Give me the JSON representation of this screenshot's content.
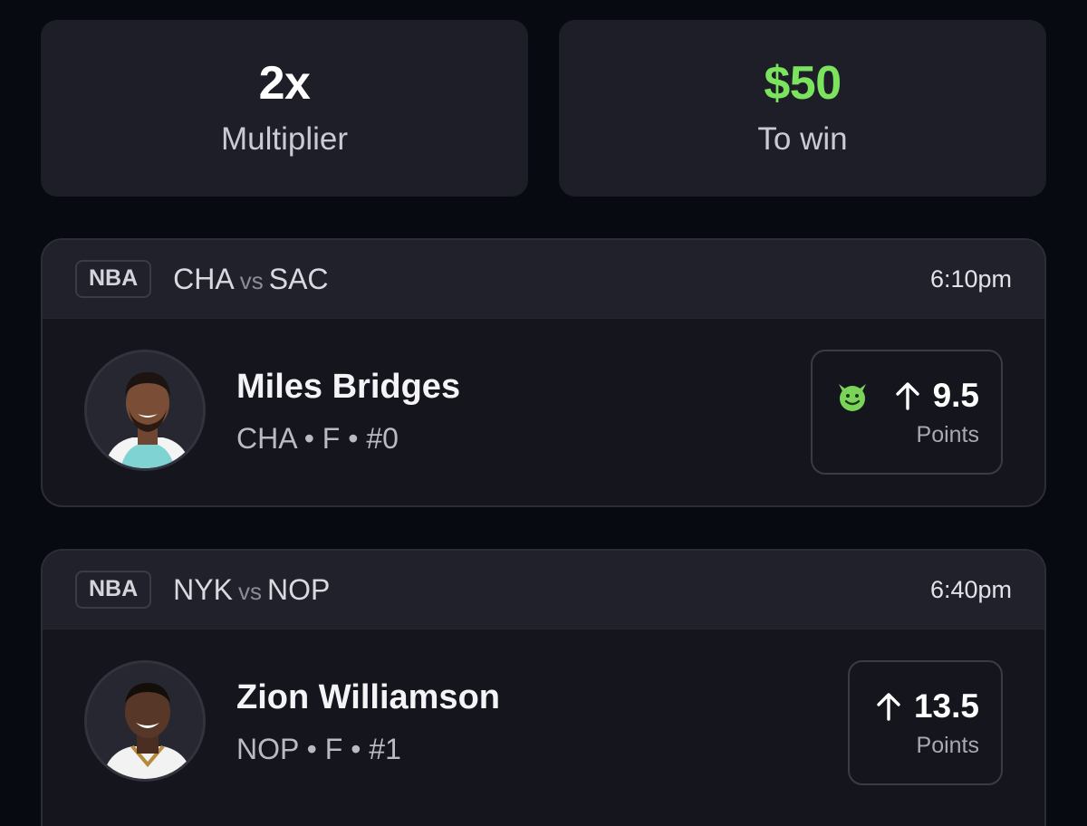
{
  "summary": {
    "multiplier_value": "2x",
    "multiplier_label": "Multiplier",
    "to_win_value": "$50",
    "to_win_label": "To win"
  },
  "picks": [
    {
      "league": "NBA",
      "team_a": "CHA",
      "vs": "vs",
      "team_b": "SAC",
      "time": "6:10pm",
      "player_name": "Miles Bridges",
      "player_meta": "CHA • F • #0",
      "direction_icon": "arrow-up-icon",
      "line": "9.5",
      "stat": "Points",
      "badge_icon": "devil-emoji-icon",
      "jersey_color": "#7fd3d3"
    },
    {
      "league": "NBA",
      "team_a": "NYK",
      "vs": "vs",
      "team_b": "NOP",
      "time": "6:40pm",
      "player_name": "Zion Williamson",
      "player_meta": "NOP • F • #1",
      "direction_icon": "arrow-up-icon",
      "line": "13.5",
      "stat": "Points",
      "jersey_color": "#f2f2f2"
    }
  ],
  "colors": {
    "background": "#080a12",
    "win_green": "#7ce35f"
  }
}
